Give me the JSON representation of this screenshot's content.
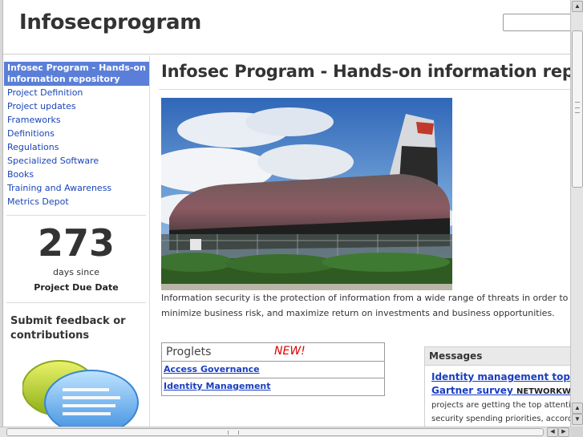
{
  "header": {
    "site_title": "Infosecprogram",
    "search_placeholder": ""
  },
  "sidebar": {
    "nav_items": [
      {
        "label": "Infosec Program - Hands-on information repository",
        "active": true
      },
      {
        "label": "Project Definition"
      },
      {
        "label": "Project updates"
      },
      {
        "label": "Frameworks"
      },
      {
        "label": "Definitions"
      },
      {
        "label": "Regulations"
      },
      {
        "label": "Specialized Software"
      },
      {
        "label": "Books"
      },
      {
        "label": "Training and Awareness"
      },
      {
        "label": "Metrics Depot"
      }
    ],
    "counter": {
      "number": "273",
      "caption": "days since",
      "label": "Project Due Date"
    },
    "feedback_heading": "Submit feedback or contributions",
    "feedback_icon": "speech-bubbles-icon"
  },
  "main": {
    "page_title": "Infosec Program - Hands-on information repository",
    "hero_image": "space-shuttle-photo",
    "intro_line1": "Information security is the protection of information from a wide range of threats in order to ensure business continuity,",
    "intro_line2": "minimize business risk, and maximize return on investments and business opportunities.",
    "proglets": {
      "title": "Proglets",
      "new_badge": "NEW!",
      "items": [
        "Access Governance",
        "Identity Management"
      ]
    },
    "messages": {
      "title": "Messages",
      "headline": "Identity management top security",
      "headline2": "Gartner survey",
      "source": "NETWORKWORLD",
      "body_line1": "projects are getting the top attention in",
      "body_line2": "security spending priorities, according to"
    }
  },
  "colors": {
    "nav_active_bg": "#5b7fd8",
    "link": "#1a45b8",
    "new_badge": "#e00000"
  }
}
